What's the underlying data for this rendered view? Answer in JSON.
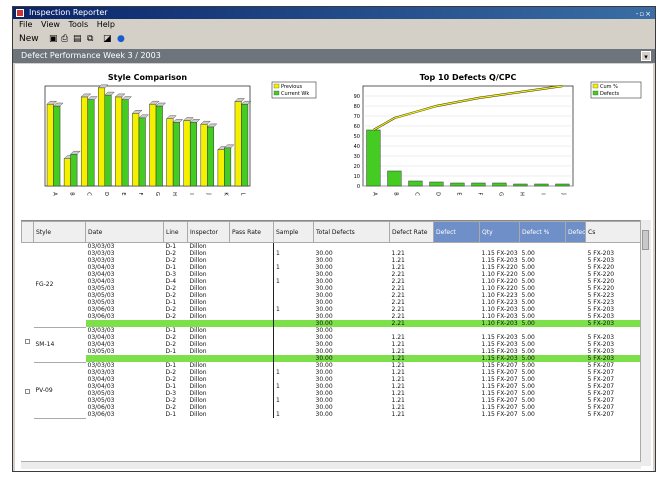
{
  "window": {
    "title": "Inspection Reporter",
    "buttons": "-▫×"
  },
  "menu": [
    "File",
    "View",
    "Tools",
    "Help"
  ],
  "toolbar": {
    "new_label": "New"
  },
  "header": {
    "label": "Defect Performance Week 3 / 2003"
  },
  "colors": {
    "bar_yellow": "#f4f000",
    "bar_green": "#44cc22",
    "highlight": "#7ddf4a",
    "header_blue": "#6f8fc8",
    "title_bg": "#0a246a"
  },
  "chart_data": [
    {
      "type": "bar",
      "title": "Style Comparison",
      "categories": [
        "A",
        "B",
        "C",
        "D",
        "E",
        "F",
        "G",
        "H",
        "I",
        "J",
        "K",
        "L"
      ],
      "series": [
        {
          "name": "Previous",
          "values": [
            90,
            30,
            98,
            108,
            98,
            80,
            90,
            74,
            72,
            68,
            40,
            93
          ]
        },
        {
          "name": "Current Wk",
          "values": [
            88,
            35,
            95,
            100,
            95,
            75,
            88,
            70,
            70,
            65,
            42,
            90
          ]
        }
      ],
      "ylim": [
        0,
        110
      ]
    },
    {
      "type": "bar",
      "title": "Top 10 Defects Q/CPC",
      "categories": [
        "A",
        "B",
        "C",
        "D",
        "E",
        "F",
        "G",
        "H",
        "I",
        "J"
      ],
      "series": [
        {
          "name": "Cum %",
          "values": [
            56,
            68,
            74,
            80,
            84,
            88,
            91,
            94,
            97,
            100
          ]
        },
        {
          "name": "Defects",
          "values": [
            56,
            15,
            5,
            4,
            3,
            3,
            3,
            2,
            2,
            2
          ]
        }
      ],
      "ylim": [
        0,
        100
      ],
      "yticks": [
        "0",
        "10",
        "20",
        "30",
        "40",
        "50",
        "60",
        "70",
        "80",
        "90"
      ]
    }
  ],
  "table": {
    "headers": [
      "Style",
      "Date",
      "Line",
      "Inspector",
      "Pass Rate",
      "Sample",
      "Total Defects",
      "Defect Rate",
      "Defect",
      "Qty",
      "Defect %",
      "Defect",
      "Cs"
    ],
    "groups": [
      "FG-22",
      "SM-14",
      "PV-09"
    ],
    "rows": [
      [
        "03/03/03",
        "D-1",
        "Dillon",
        "",
        "",
        "",
        "",
        "",
        "",
        "",
        ""
      ],
      [
        "03/03/03",
        "D-2",
        "Dillon",
        "1",
        "30.00",
        "1.21",
        "1.15 FX-203",
        "5.00",
        "5 FX-203"
      ],
      [
        "03/03/03",
        "D-2",
        "Dillon",
        "",
        "30.00",
        "1.21",
        "1.15 FX-203",
        "5.00",
        "5 FX-203"
      ],
      [
        "03/04/03",
        "D-1",
        "Dillon",
        "1",
        "30.00",
        "1.21",
        "1.15 FX-220",
        "5.00",
        "5 FX-220"
      ],
      [
        "03/04/03",
        "D-3",
        "Dillon",
        "",
        "30.00",
        "2.21",
        "1.10 FX-220",
        "5.00",
        "5 FX-220"
      ],
      [
        "03/04/03",
        "D-4",
        "Dillon",
        "1",
        "30.00",
        "2.21",
        "1.10 FX-220",
        "5.00",
        "5 FX-220"
      ],
      [
        "03/05/03",
        "D-2",
        "Dillon",
        "",
        "30.00",
        "2.21",
        "1.10 FX-220",
        "5.00",
        "5 FX-220"
      ],
      [
        "03/05/03",
        "D-2",
        "Dillon",
        "",
        "30.00",
        "2.21",
        "1.10 FX-223",
        "5.00",
        "5 FX-223"
      ],
      [
        "03/05/03",
        "D-1",
        "Dillon",
        "",
        "30.00",
        "2.21",
        "1.10 FX-223",
        "5.00",
        "5 FX-223"
      ],
      [
        "03/06/03",
        "D-2",
        "Dillon",
        "1",
        "30.00",
        "2.21",
        "1.10 FX-203",
        "5.00",
        "5 FX-203"
      ],
      [
        "03/06/03",
        "D-2",
        "Dillon",
        "",
        "30.00",
        "2.21",
        "1.10 FX-203",
        "5.00",
        "5 FX-203"
      ],
      [
        "",
        "",
        "",
        "",
        "30.00",
        "2.21",
        "1.10 FX-203",
        "5.00",
        "5 FX-203"
      ],
      [
        "03/03/03",
        "D-1",
        "Dillon",
        "",
        "30.00",
        "",
        "",
        "",
        ""
      ],
      [
        "03/04/03",
        "D-2",
        "Dillon",
        "",
        "30.00",
        "1.21",
        "1.15 FX-203",
        "5.00",
        "5 FX-203"
      ],
      [
        "03/04/03",
        "D-2",
        "Dillon",
        "",
        "30.00",
        "1.21",
        "1.15 FX-203",
        "5.00",
        "5 FX-203"
      ],
      [
        "03/05/03",
        "D-1",
        "Dillon",
        "",
        "30.00",
        "1.21",
        "1.15 FX-203",
        "5.00",
        "5 FX-203"
      ],
      [
        "",
        "",
        "",
        "",
        "30.00",
        "1.21",
        "1.15 FX-203",
        "5.00",
        "5 FX-203"
      ],
      [
        "03/03/03",
        "D-1",
        "Dillon",
        "",
        "30.00",
        "1.21",
        "1.15 FX-207",
        "5.00",
        "5 FX-207"
      ],
      [
        "03/03/03",
        "D-2",
        "Dillon",
        "1",
        "30.00",
        "1.21",
        "1.15 FX-207",
        "5.00",
        "5 FX-207"
      ],
      [
        "03/04/03",
        "D-2",
        "Dillon",
        "",
        "30.00",
        "1.21",
        "1.15 FX-207",
        "5.00",
        "5 FX-207"
      ],
      [
        "03/04/03",
        "D-1",
        "Dillon",
        "1",
        "30.00",
        "1.21",
        "1.15 FX-207",
        "5.00",
        "5 FX-207"
      ],
      [
        "03/05/03",
        "D-3",
        "Dillon",
        "",
        "30.00",
        "1.21",
        "1.15 FX-207",
        "5.00",
        "5 FX-207"
      ],
      [
        "03/05/03",
        "D-2",
        "Dillon",
        "1",
        "30.00",
        "1.21",
        "1.15 FX-207",
        "5.00",
        "5 FX-207"
      ],
      [
        "03/06/03",
        "D-2",
        "Dillon",
        "",
        "30.00",
        "1.21",
        "1.15 FX-207",
        "5.00",
        "5 FX-207"
      ],
      [
        "03/06/03",
        "D-1",
        "Dillon",
        "1",
        "30.00",
        "1.21",
        "1.15 FX-207",
        "5.00",
        "5 FX-207"
      ]
    ],
    "highlight_rows": [
      11,
      16
    ]
  }
}
